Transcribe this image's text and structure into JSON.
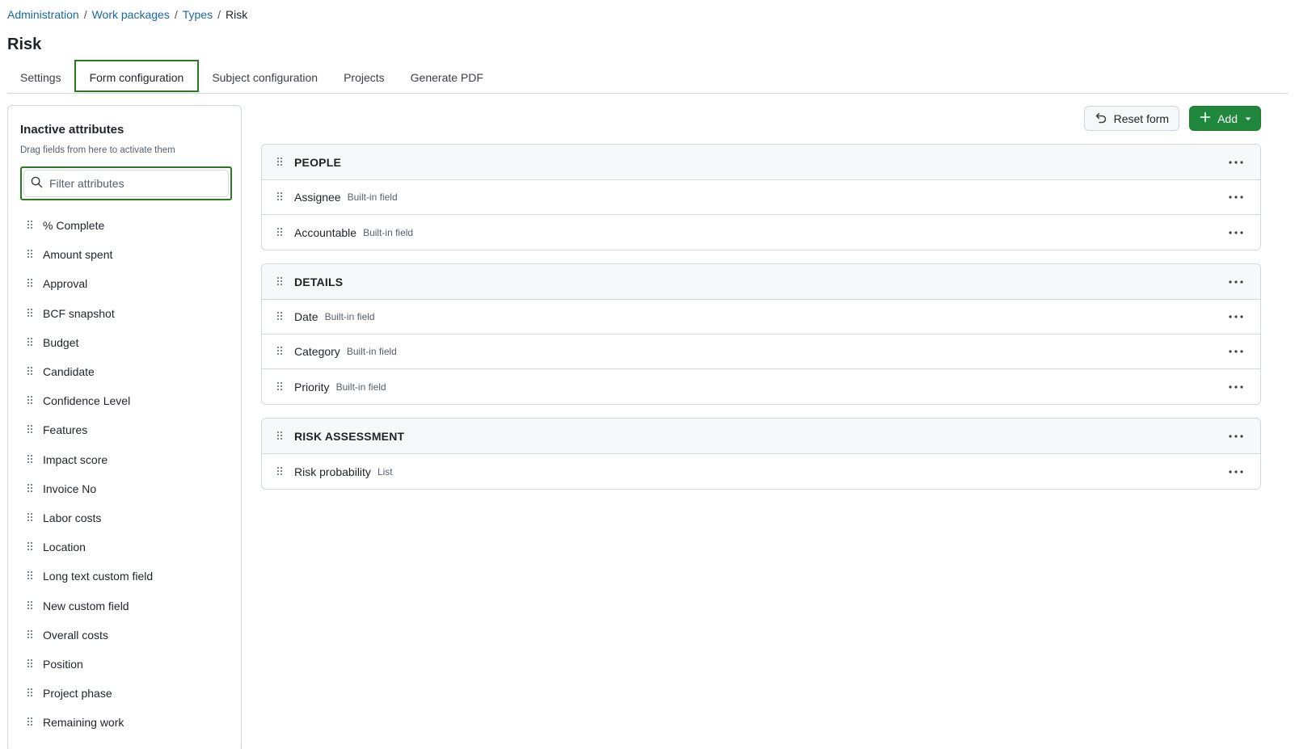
{
  "breadcrumb": {
    "items": [
      "Administration",
      "Work packages",
      "Types"
    ],
    "current": "Risk"
  },
  "page": {
    "title": "Risk"
  },
  "tabs": [
    {
      "label": "Settings",
      "active": false
    },
    {
      "label": "Form configuration",
      "active": true
    },
    {
      "label": "Subject configuration",
      "active": false
    },
    {
      "label": "Projects",
      "active": false
    },
    {
      "label": "Generate PDF",
      "active": false
    }
  ],
  "sidebar": {
    "title": "Inactive attributes",
    "hint": "Drag fields from here to activate them",
    "filter_placeholder": "Filter attributes",
    "filter_value": "",
    "items": [
      "% Complete",
      "Amount spent",
      "Approval",
      "BCF snapshot",
      "Budget",
      "Candidate",
      "Confidence Level",
      "Features",
      "Impact score",
      "Invoice No",
      "Labor costs",
      "Location",
      "Long text custom field",
      "New custom field",
      "Overall costs",
      "Position",
      "Project phase",
      "Remaining work"
    ]
  },
  "toolbar": {
    "reset_label": "Reset form",
    "add_label": "Add"
  },
  "groups": [
    {
      "name": "PEOPLE",
      "rows": [
        {
          "label": "Assignee",
          "type": "Built-in field"
        },
        {
          "label": "Accountable",
          "type": "Built-in field"
        }
      ]
    },
    {
      "name": "DETAILS",
      "rows": [
        {
          "label": "Date",
          "type": "Built-in field"
        },
        {
          "label": "Category",
          "type": "Built-in field"
        },
        {
          "label": "Priority",
          "type": "Built-in field"
        }
      ]
    },
    {
      "name": "RISK ASSESSMENT",
      "rows": [
        {
          "label": "Risk probability",
          "type": "List"
        }
      ]
    }
  ],
  "colors": {
    "accent_green": "#1f883d",
    "focus_outline": "#2c7a1f",
    "link_blue": "#1a67a3"
  },
  "icons": {
    "drag": "drag-handle-icon",
    "search": "search-icon",
    "undo": "undo-icon",
    "plus": "plus-icon",
    "caret": "caret-down-icon",
    "more": "more-horizontal-icon"
  }
}
